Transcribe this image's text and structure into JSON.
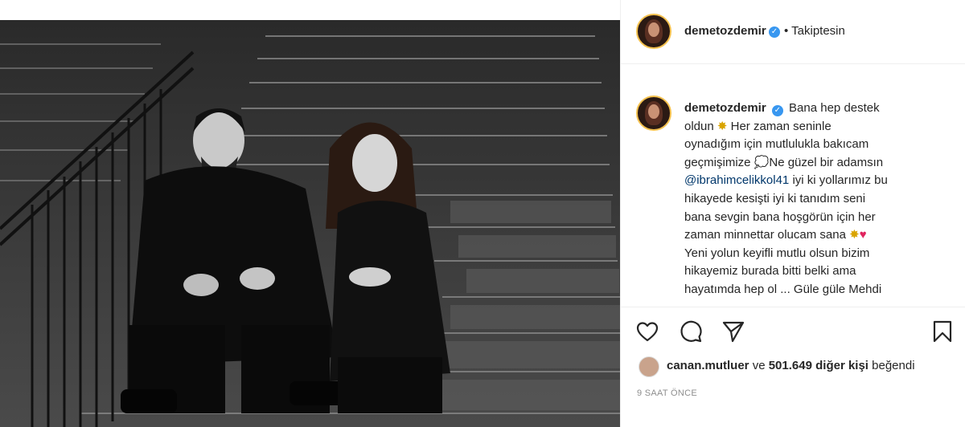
{
  "post": {
    "username": "demetozdemir",
    "follow_status": "• Takiptesin",
    "caption": {
      "username": "demetozdemir",
      "line1": "Bana hep destek",
      "line2": "oldun",
      "line2b": "Her zaman seninle",
      "line3": "oynadığım için mutlulukla bakıcam",
      "line4": "geçmişimize",
      "line4b": "Ne güzel bir adamsın",
      "mention": "@ibrahimcelikkol41",
      "line5b": "iyi ki yollarımız bu",
      "line6": "hikayede kesişti iyi ki tanıdım seni",
      "line7": "bana sevgin bana hoşgörün için her",
      "line8": "zaman minnettar olucam sana",
      "line9": "Yeni yolun keyifli mutlu olsun bizim",
      "line10": "hikayemiz burada bitti belki ama",
      "line11": "hayatımda hep ol ... Güle güle Mehdi"
    },
    "likes": {
      "user": "canan.mutluer",
      "connector": "ve",
      "count": "501.649 diğer kişi",
      "suffix": "beğendi"
    },
    "time": "9 SAAT ÖNCE"
  },
  "icons": {
    "like": "heart-outline-icon",
    "comment": "comment-icon",
    "share": "paper-plane-icon",
    "save": "bookmark-icon",
    "verified": "verified-badge-icon"
  },
  "colors": {
    "verified": "#3897f0",
    "text": "#262626",
    "mention": "#00376b",
    "muted": "#8e8e8e",
    "avatar_ring": "#f4c14e"
  }
}
